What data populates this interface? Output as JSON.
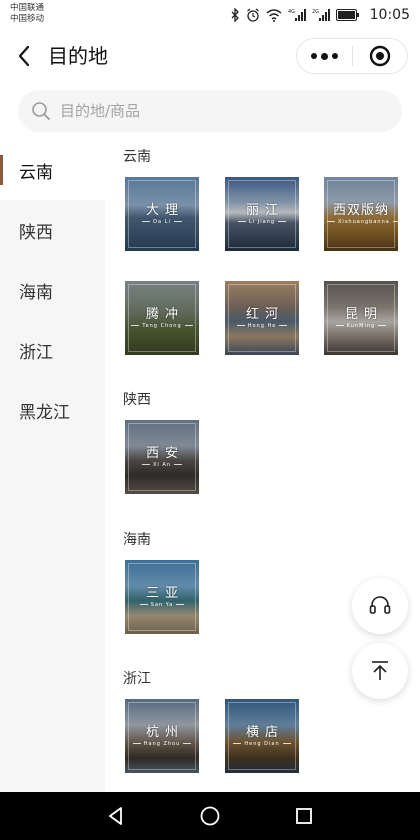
{
  "status_bar": {
    "carrier_1": "中国联通",
    "carrier_2": "中国移动",
    "network_1": "4G",
    "network_2": "2G",
    "time": "10:05"
  },
  "nav": {
    "title": "目的地"
  },
  "search": {
    "placeholder": "目的地/商品"
  },
  "sidebar": {
    "items": [
      {
        "label": "云南",
        "active": true
      },
      {
        "label": "陕西",
        "active": false
      },
      {
        "label": "海南",
        "active": false
      },
      {
        "label": "浙江",
        "active": false
      },
      {
        "label": "黑龙江",
        "active": false
      }
    ]
  },
  "sections": [
    {
      "title": "云南",
      "cities": [
        {
          "name": "大理",
          "pinyin": "Da Li",
          "theme": "lake-blue"
        },
        {
          "name": "丽江",
          "pinyin": "Li Jiang",
          "theme": "snow-mountain"
        },
        {
          "name": "西双版纳",
          "pinyin": "Xishuangbanna",
          "theme": "golden-temple"
        },
        {
          "name": "腾冲",
          "pinyin": "Teng Chong",
          "theme": "grassland"
        },
        {
          "name": "红河",
          "pinyin": "Hong He",
          "theme": "terrace"
        },
        {
          "name": "昆明",
          "pinyin": "KunMing",
          "theme": "gull"
        }
      ]
    },
    {
      "title": "陕西",
      "cities": [
        {
          "name": "西安",
          "pinyin": "Xi An",
          "theme": "city-wall"
        }
      ]
    },
    {
      "title": "海南",
      "cities": [
        {
          "name": "三亚",
          "pinyin": "San Ya",
          "theme": "beach"
        }
      ]
    },
    {
      "title": "浙江",
      "cities": [
        {
          "name": "杭州",
          "pinyin": "Hang Zhou",
          "theme": "west-lake"
        },
        {
          "name": "横店",
          "pinyin": "Heng Dian",
          "theme": "palace"
        }
      ]
    }
  ],
  "floating": {
    "service_icon": "headset-icon",
    "top_icon": "back-to-top-icon"
  },
  "colors": {
    "accent": "#8a5a3c",
    "sidebar_bg": "#f6f6f6",
    "search_bg": "#f5f5f5"
  }
}
